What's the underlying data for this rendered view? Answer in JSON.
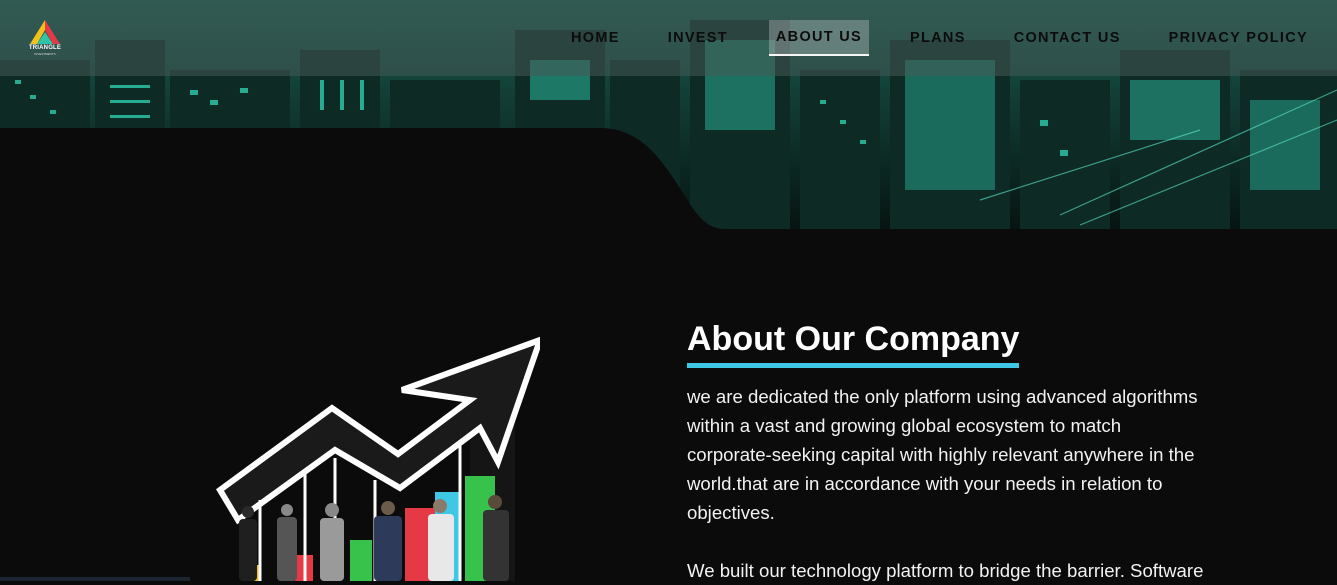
{
  "brand": {
    "logo_text": "TRIANGLE",
    "logo_sub": "INVESTMENTS",
    "colors": [
      "#e63946",
      "#f2c21b",
      "#2ec4a6",
      "#2b7cd3"
    ]
  },
  "nav": {
    "items": [
      {
        "label": "HOME",
        "active": false
      },
      {
        "label": "INVEST",
        "active": false
      },
      {
        "label": "ABOUT US",
        "active": true
      },
      {
        "label": "PLANS",
        "active": false
      },
      {
        "label": "CONTACT US",
        "active": false
      },
      {
        "label": "PRIVACY POLICY",
        "active": false
      }
    ]
  },
  "about": {
    "title": "About Our Company",
    "paragraphs": [
      "we are dedicated the only platform using advanced algorithms within a vast and growing global ecosystem to match corporate-seeking capital with highly relevant anywhere in the world.that are in accordance with your needs in relation to objectives.",
      "We built our technology platform to bridge the barrier. Software"
    ]
  },
  "theme": {
    "accent": "#3ec8e6",
    "teal": "#2ec4a6",
    "background": "#0b0b0b"
  }
}
